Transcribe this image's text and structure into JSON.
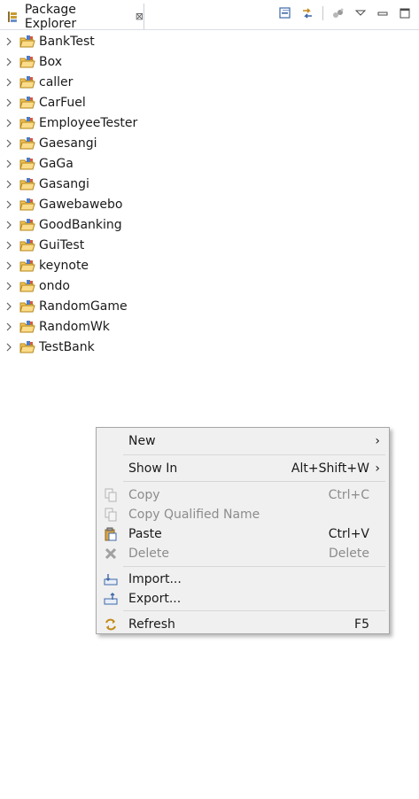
{
  "view": {
    "title": "Package Explorer",
    "close_glyph": "⊠"
  },
  "toolbar_icons": [
    "collapse-all-icon",
    "link-with-editor-icon",
    "filters-icon",
    "view-menu-icon",
    "minimize-icon",
    "maximize-icon"
  ],
  "projects": [
    "BankTest",
    "Box",
    "caller",
    "CarFuel",
    "EmployeeTester",
    "Gaesangi",
    "GaGa",
    "Gasangi",
    "Gawebawebo",
    "GoodBanking",
    "GuiTest",
    "keynote",
    "ondo",
    "RandomGame",
    "RandomWk",
    "TestBank"
  ],
  "context_menu": {
    "new": {
      "label": "New",
      "arrow": "›"
    },
    "show_in": {
      "label": "Show In",
      "accel": "Alt+Shift+W",
      "arrow": "›"
    },
    "copy": {
      "label": "Copy",
      "accel": "Ctrl+C",
      "enabled": false
    },
    "copy_qualified": {
      "label": "Copy Qualified Name",
      "enabled": false
    },
    "paste": {
      "label": "Paste",
      "accel": "Ctrl+V",
      "enabled": true
    },
    "delete": {
      "label": "Delete",
      "accel": "Delete",
      "enabled": false
    },
    "import": {
      "label": "Import..."
    },
    "export": {
      "label": "Export..."
    },
    "refresh": {
      "label": "Refresh",
      "accel": "F5"
    }
  }
}
